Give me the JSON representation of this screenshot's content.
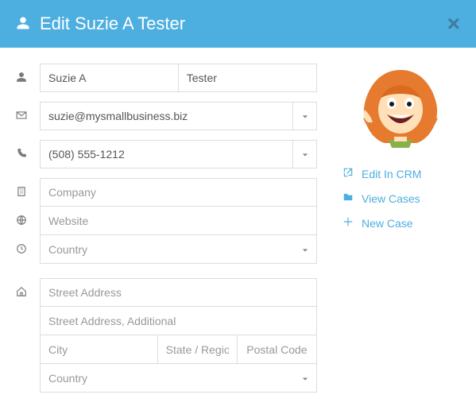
{
  "header": {
    "title": "Edit Suzie A Tester"
  },
  "form": {
    "first_name": "Suzie A",
    "last_name": "Tester",
    "email": "suzie@mysmallbusiness.biz",
    "phone": "(508) 555-1212",
    "company_ph": "Company",
    "website_ph": "Website",
    "country1_ph": "Country",
    "street1_ph": "Street Address",
    "street2_ph": "Street Address, Additional",
    "city_ph": "City",
    "state_ph": "State / Region",
    "postal_ph": "Postal Code",
    "country2_ph": "Country"
  },
  "side": {
    "edit_crm": "Edit In CRM",
    "view_cases": "View Cases",
    "new_case": "New Case"
  },
  "colors": {
    "accent": "#4daee0"
  }
}
